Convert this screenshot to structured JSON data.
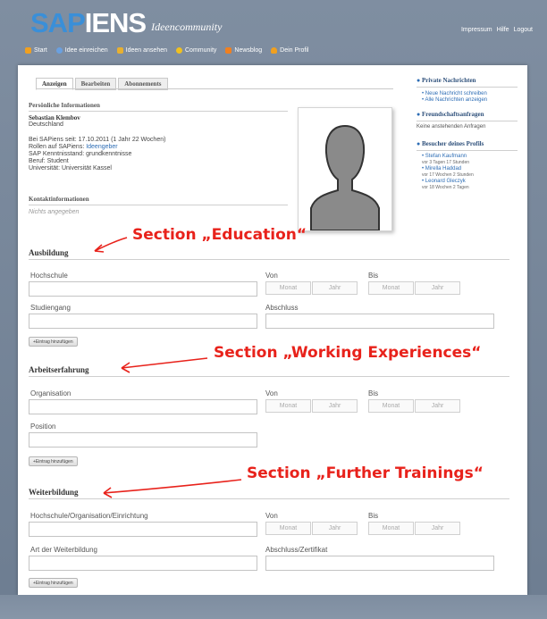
{
  "header": {
    "logo_sap": "SAP",
    "logo_iens": "IENS",
    "logo_sub": "Ideencommunity",
    "toplinks": [
      "Impressum",
      "Hilfe",
      "Logout"
    ],
    "nav": [
      {
        "label": "Start",
        "icon": "home-icon",
        "color": "#f0a020"
      },
      {
        "label": "Idee einreichen",
        "icon": "magnifier-icon",
        "color": "#6aa0e0"
      },
      {
        "label": "Ideen ansehen",
        "icon": "folder-icon",
        "color": "#e8b030"
      },
      {
        "label": "Community",
        "icon": "community-icon",
        "color": "#f0c020"
      },
      {
        "label": "Newsblog",
        "icon": "rss-icon",
        "color": "#f08020"
      },
      {
        "label": "Dein Profil",
        "icon": "person-icon",
        "color": "#f0a020"
      }
    ]
  },
  "tabs": [
    "Anzeigen",
    "Bearbeiten",
    "Abonnements"
  ],
  "profile": {
    "section_personal": "Persönliche Informationen",
    "name": "Sebastian Klembov",
    "country": "Deutschland",
    "since_prefix": "Bei SAPiens seit: ",
    "since_value": "17.10.2011 (1 Jahr 22 Wochen)",
    "roles_prefix": "Rollen auf SAPiens: ",
    "roles_value": "Ideengeber",
    "sap_knowledge": "SAP Kenntnisstand: grundkenntnisse",
    "job": "Beruf: Student",
    "university": "Universität: Universität Kassel",
    "section_contact": "Kontaktinformationen",
    "contact_empty": "Nichts angegeben"
  },
  "sidebar": {
    "messages_title": "Private Nachrichten",
    "messages_links": [
      "Neue Nachricht schreiben",
      "Alle Nachrichten anzeigen"
    ],
    "friends_title": "Freundschaftsanfragen",
    "friends_empty": "Keine anstehenden Anfragen",
    "visitors_title": "Besucher deines Profils",
    "visitors": [
      {
        "name": "Stefan Kaufmann",
        "when": "vor 3 Tagen 17 Stunden"
      },
      {
        "name": "Mirella Haddad",
        "when": "vor 17 Wochen 2 Stunden"
      },
      {
        "name": "Leonard Gleczyk",
        "when": "vor 18 Wochen 2 Tagen"
      }
    ]
  },
  "form": {
    "education": {
      "title": "Ausbildung",
      "label_school": "Hochschule",
      "label_from": "Von",
      "label_to": "Bis",
      "label_course": "Studiengang",
      "label_degree": "Abschluss",
      "button": "+Eintrag hinzufügen"
    },
    "work": {
      "title": "Arbeitserfahrung",
      "label_org": "Organisation",
      "label_from": "Von",
      "label_to": "Bis",
      "label_position": "Position",
      "button": "+Eintrag hinzufügen"
    },
    "training": {
      "title": "Weiterbildung",
      "label_org": "Hochschule/Organisation/Einrichtung",
      "label_from": "Von",
      "label_to": "Bis",
      "label_type": "Art der Weiterbildung",
      "label_cert": "Abschluss/Zertifikat",
      "button": "+Eintrag hinzufügen"
    },
    "month": "Monat",
    "year": "Jahr"
  },
  "annotations": {
    "education": "Section „Education“",
    "work": "Section „Working Experiences“",
    "training": "Section „Further Trainings“",
    "color": "#e8221b"
  }
}
